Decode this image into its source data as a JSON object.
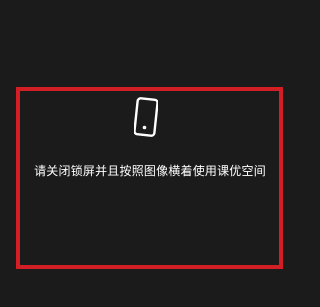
{
  "overlay": {
    "message": "请关闭锁屏并且按照图像横着使用课优空间",
    "icon": "phone-portrait-icon",
    "frame_color": "#d21f26",
    "background_color": "#1b1b1b",
    "text_color": "#ffffff"
  }
}
